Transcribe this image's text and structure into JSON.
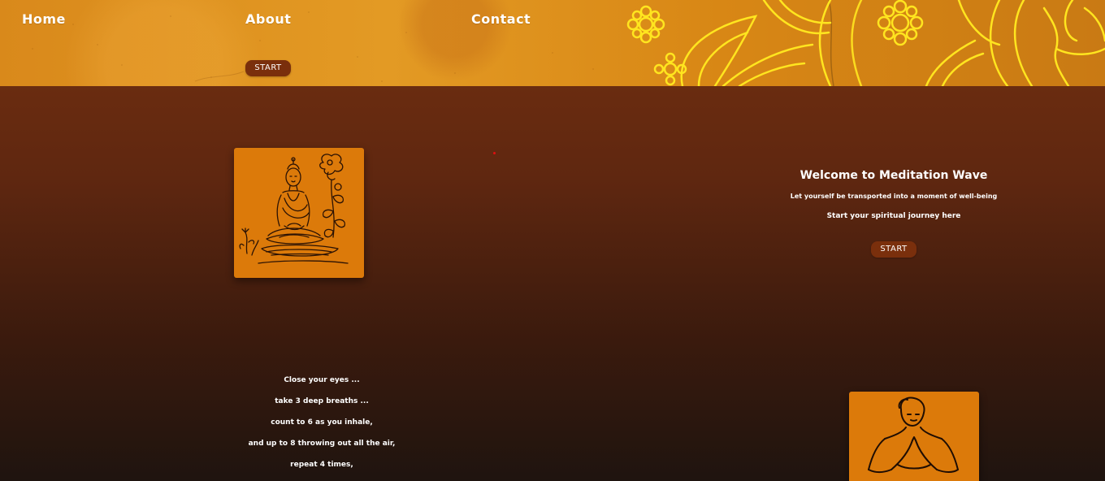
{
  "nav": {
    "items": [
      {
        "label": "Home"
      },
      {
        "label": "About"
      },
      {
        "label": "Contact"
      }
    ]
  },
  "header": {
    "start_label": "START"
  },
  "welcome": {
    "title": "Welcome to Meditation Wave",
    "subtitle": "Let yourself be transported into a moment of well-being",
    "cta_text": "Start your spiritual journey here",
    "start_label": "START"
  },
  "instructions": [
    "Close your eyes ...",
    "take 3 deep breaths ...",
    "count to 6 as you inhale,",
    "and up to 8 throwing out all the air,",
    "repeat 4 times,"
  ],
  "colors": {
    "banner": "#d9891b",
    "mandala": "#ffe51f",
    "button": "#7a2f0c",
    "card": "#dc7a0a",
    "background_top": "#74300f",
    "background_bottom": "#1f140f"
  },
  "images": {
    "card1": "buddha-meditating-illustration",
    "card2": "praying-figure-illustration",
    "banner_decoration": "mandala-pattern"
  }
}
